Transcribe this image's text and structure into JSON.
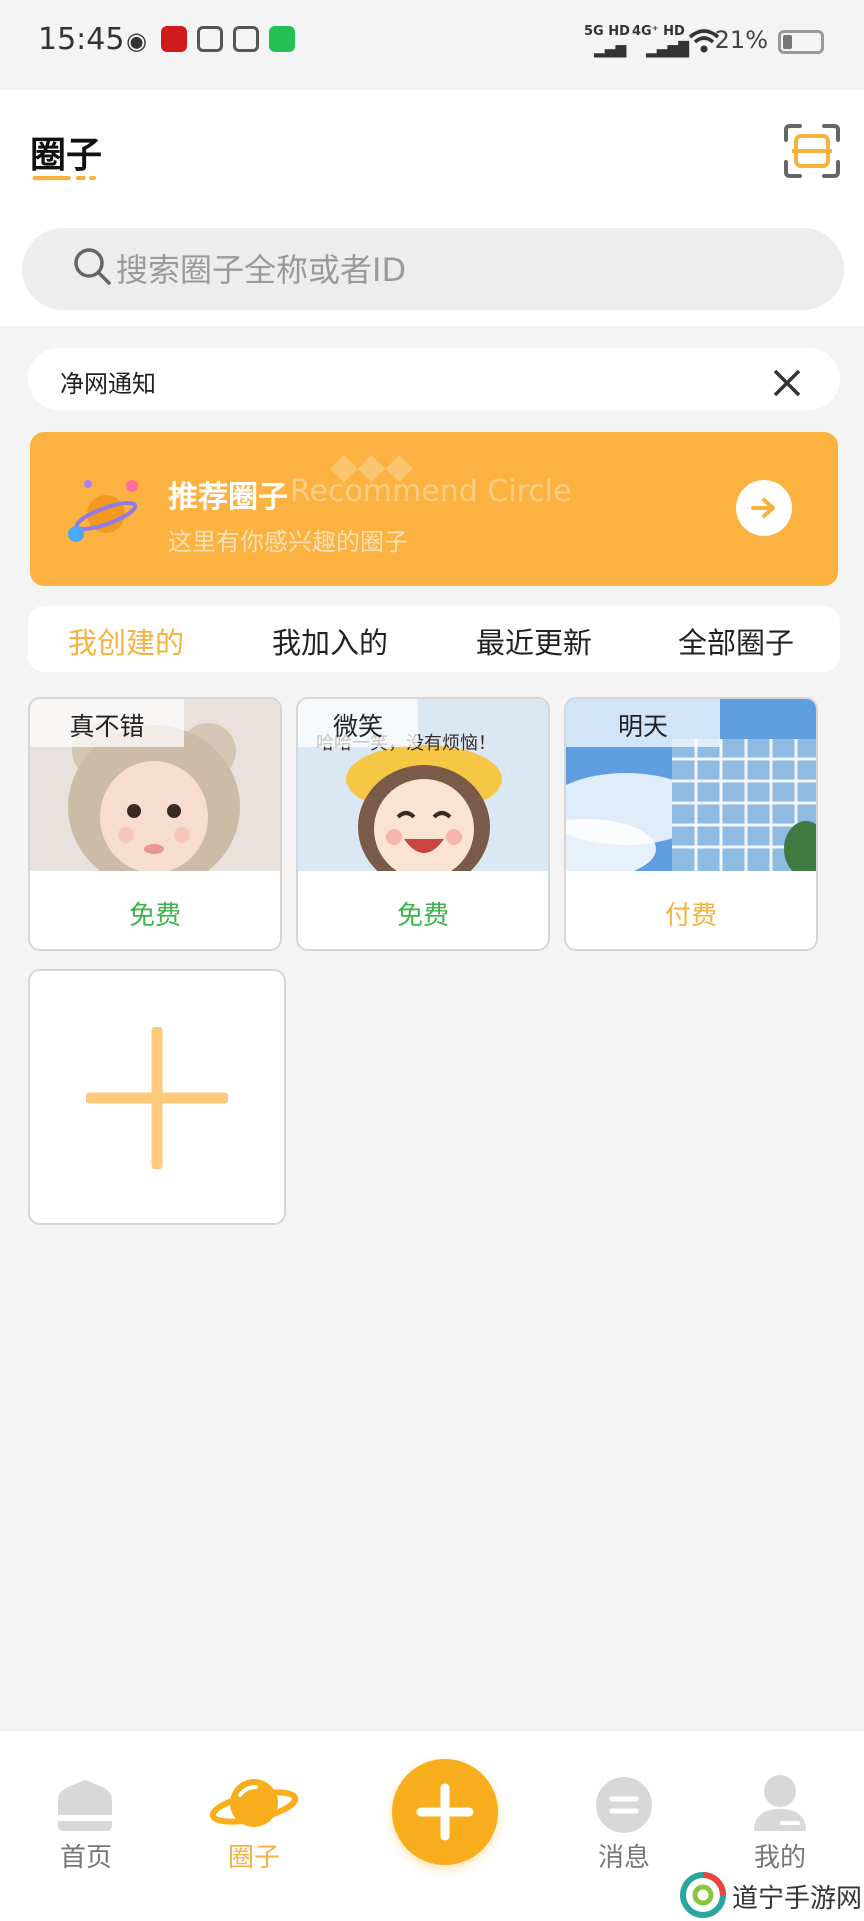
{
  "status_bar": {
    "time": "15:45",
    "signal1": "5G HD",
    "signal2": "4G⁺ HD",
    "battery": "21%"
  },
  "header": {
    "title": "圈子",
    "search_placeholder": "搜索圈子全称或者ID"
  },
  "notice": {
    "text": "净网通知"
  },
  "banner": {
    "title": "推荐圈子",
    "title_en": "Recommend Circle",
    "desc": "这里有你感兴趣的圈子"
  },
  "tabs": [
    {
      "label": "我创建的",
      "active": true
    },
    {
      "label": "我加入的",
      "active": false
    },
    {
      "label": "最近更新",
      "active": false
    },
    {
      "label": "全部圈子",
      "active": false
    }
  ],
  "circles": [
    {
      "name": "真不错",
      "price": "免费"
    },
    {
      "name": "微笑",
      "price": "免费",
      "image_text": "哈哈一笑，没有烦恼！"
    },
    {
      "name": "明天",
      "price": "付费"
    }
  ],
  "bottom_nav": [
    {
      "label": "首页",
      "icon": "home-icon"
    },
    {
      "label": "圈子",
      "icon": "planet-icon",
      "active": true
    },
    {
      "label": "",
      "icon": "plus-icon"
    },
    {
      "label": "消息",
      "icon": "message-icon"
    },
    {
      "label": "我的",
      "icon": "profile-icon"
    }
  ],
  "watermark": {
    "text": "道宁手游网"
  },
  "colors": {
    "accent": "#f6b13f",
    "banner": "#fbb240",
    "free": "#3cb44b"
  }
}
